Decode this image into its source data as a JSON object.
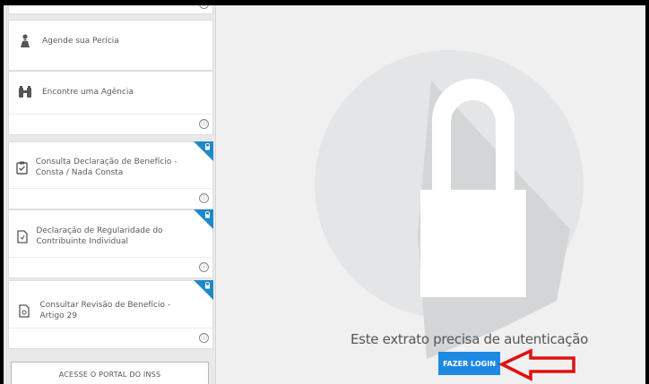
{
  "sidebar": {
    "items": [
      {
        "label": "Agende sua Perícia",
        "icon": "person-icon",
        "locked": false
      },
      {
        "label": "Encontre uma Agência",
        "icon": "binoculars-icon",
        "locked": false
      },
      {
        "label": "Consulta Declaração de Benefício - Consta / Nada Consta",
        "icon": "clipboard-check-icon",
        "locked": true
      },
      {
        "label": "Declaração de Regularidade do Contribuinte Individual",
        "icon": "document-icon",
        "locked": true
      },
      {
        "label": "Consultar Revisão de Benefício - Artigo 29",
        "icon": "document-icon",
        "locked": true
      }
    ],
    "info_glyph": "ⓘ",
    "portal_button": "ACESSE O PORTAL DO INSS"
  },
  "main": {
    "message": "Este extrato precisa de autenticação",
    "login_button": "FAZER LOGIN"
  },
  "colors": {
    "accent": "#1e88c8",
    "button": "#1e88e5",
    "arrow": "#e01010"
  }
}
